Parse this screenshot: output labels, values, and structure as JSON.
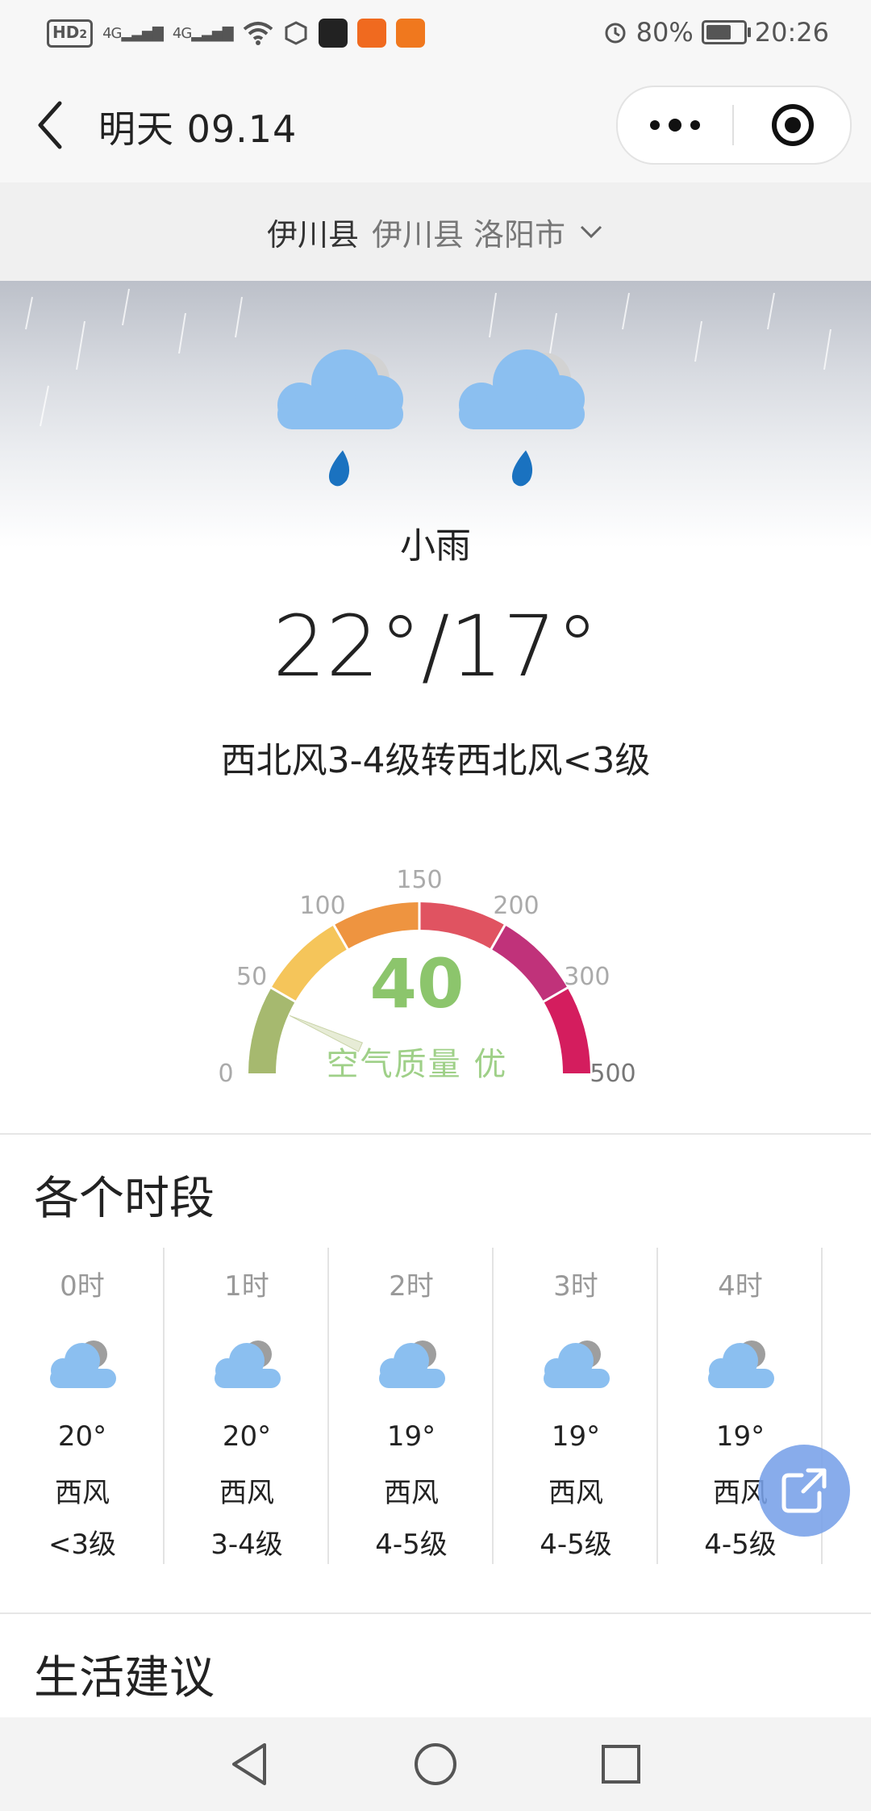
{
  "status_bar": {
    "hd": "HD",
    "hd_sub": "2",
    "signal1": "4G",
    "signal2": "4G",
    "battery_pct": "80%",
    "battery_level": 0.8,
    "time": "20:26"
  },
  "title_bar": {
    "title": "明天  09.14"
  },
  "location": {
    "main": "伊川县",
    "sub": "伊川县 洛阳市"
  },
  "weather": {
    "condition": "小雨",
    "temperature": "22°/17°",
    "wind": "西北风3-4级转西北风<3级"
  },
  "aqi": {
    "value": "40",
    "label": "空气质量 优",
    "ticks": [
      "0",
      "50",
      "100",
      "150",
      "200",
      "300",
      "500"
    ],
    "colors": {
      "good": "#a6b96f",
      "moderate": "#f5c55a",
      "usg": "#ee9440",
      "unhealthy": "#e05361",
      "very_unhealthy": "#c0327a",
      "hazardous": "#d41d5e",
      "value_text": "#8cc56c"
    }
  },
  "hourly": {
    "title": "各个时段",
    "items": [
      {
        "time": "0时",
        "temp": "20°",
        "dir": "西风",
        "level": "<3级"
      },
      {
        "time": "1时",
        "temp": "20°",
        "dir": "西风",
        "level": "3-4级"
      },
      {
        "time": "2时",
        "temp": "19°",
        "dir": "西风",
        "level": "4-5级"
      },
      {
        "time": "3时",
        "temp": "19°",
        "dir": "西风",
        "level": "4-5级"
      },
      {
        "time": "4时",
        "temp": "19°",
        "dir": "西风",
        "level": "4-5级"
      }
    ]
  },
  "life": {
    "title": "生活建议"
  }
}
